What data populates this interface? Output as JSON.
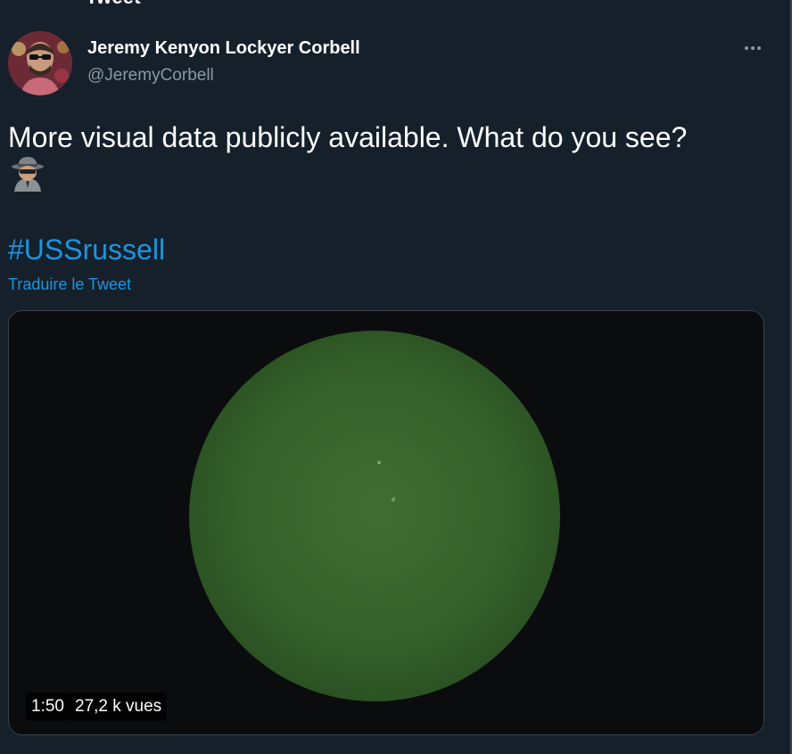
{
  "header": {
    "title": "Tweet"
  },
  "author": {
    "name": "Jeremy Kenyon Lockyer Corbell",
    "handle": "@JeremyCorbell"
  },
  "tweet": {
    "text": "More visual data publicly available. What do you see?",
    "emoji_icon": "detective-icon",
    "hashtag": "#USSrussell",
    "translate_label": "Traduire le Tweet"
  },
  "video": {
    "duration": "1:50",
    "views": "27,2 k vues"
  },
  "colors": {
    "background": "#15202b",
    "link": "#1b95e0",
    "secondary_text": "#8899a6",
    "night_vision_green": "#3a6a2e"
  }
}
